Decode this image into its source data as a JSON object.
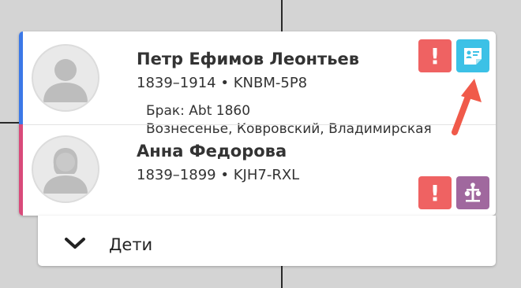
{
  "colors": {
    "male": "#3b78e7",
    "female": "#d94a7a",
    "alert": "#ef6262",
    "record": "#3cc1e6",
    "relations": "#a0689e",
    "arrow": "#f05a4a"
  },
  "couple": {
    "husband": {
      "name": "Петр Ефимов Леонтьев",
      "lifespan": "1839–1914",
      "separator": "•",
      "id": "KNBM-5P8",
      "badges": [
        {
          "icon": "alert-icon",
          "glyph": "!"
        },
        {
          "icon": "record-card-icon"
        }
      ]
    },
    "marriage": {
      "line1": "Брак: Abt 1860",
      "line2": "Вознесенье, Ковровский, Владимирская"
    },
    "wife": {
      "name": "Анна Федорова",
      "lifespan": "1839–1899",
      "separator": "•",
      "id": "KJH7-RXL",
      "badges": [
        {
          "icon": "alert-icon",
          "glyph": "!"
        },
        {
          "icon": "tree-relations-icon"
        }
      ]
    }
  },
  "children": {
    "label": "Дети"
  }
}
